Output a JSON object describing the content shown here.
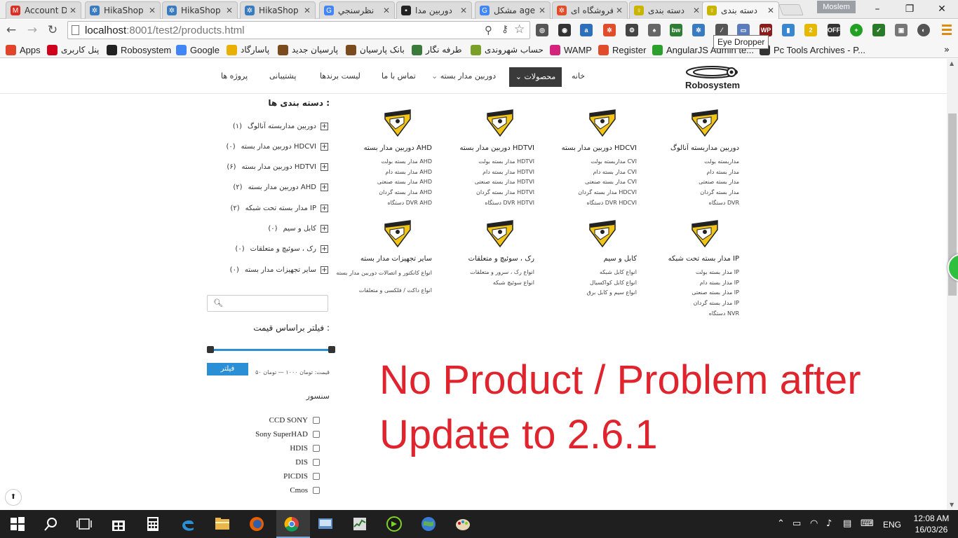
{
  "browser": {
    "tabs": [
      {
        "label": "Account D",
        "icon": "gmail-icon",
        "color": "#d93025",
        "glyph": "M"
      },
      {
        "label": "HikaShop -",
        "icon": "joomla-icon",
        "color": "#3a7bbf",
        "glyph": "✲"
      },
      {
        "label": "HikaShop -",
        "icon": "joomla-icon",
        "color": "#3a7bbf",
        "glyph": "✲"
      },
      {
        "label": "HikaShop -",
        "icon": "joomla-icon",
        "color": "#3a7bbf",
        "glyph": "✲"
      },
      {
        "label": "نظرسنجي",
        "icon": "google-icon",
        "color": "#4285f4",
        "glyph": "G"
      },
      {
        "label": "دوربين مدا",
        "icon": "camera-icon",
        "color": "#222222",
        "glyph": "▪"
      },
      {
        "label": "مشكل age",
        "icon": "google-icon",
        "color": "#4285f4",
        "glyph": "G"
      },
      {
        "label": "فروشگاه ای",
        "icon": "joomla-icon",
        "color": "#e14d2a",
        "glyph": "✲"
      },
      {
        "label": "دسته بندی",
        "icon": "bulb-icon",
        "color": "#c9b400",
        "glyph": "♀"
      },
      {
        "label": "دسته بندی",
        "icon": "bulb-icon",
        "color": "#c9b400",
        "glyph": "♀"
      }
    ],
    "profile_name": "Moslem",
    "url_host": "localhost",
    "url_rest": ":8001/test2/products.html",
    "tooltip": "Eye Dropper",
    "bookmarks": [
      {
        "label": "Apps",
        "color": "#e0452b"
      },
      {
        "label": "پنل کاربری",
        "color": "#d0021b"
      },
      {
        "label": "Robosystem",
        "color": "#222222"
      },
      {
        "label": "Google",
        "color": "#4285f4"
      },
      {
        "label": "پاسارگاد",
        "color": "#e8b000"
      },
      {
        "label": "پارسیان جدید",
        "color": "#7a4b1c"
      },
      {
        "label": "بانک پارسیان",
        "color": "#7a4b1c"
      },
      {
        "label": "طرفه نگار",
        "color": "#3a7a3a"
      },
      {
        "label": "حساب شهروندی",
        "color": "#7aa02a"
      },
      {
        "label": "WAMP",
        "color": "#d4237a"
      },
      {
        "label": "Register",
        "color": "#e14d2a"
      },
      {
        "label": "AngularJS Admin te...",
        "color": "#2ca02c"
      },
      {
        "label": "Pc Tools Archives - P...",
        "color": "#333333"
      }
    ]
  },
  "site": {
    "logo_text": "Robosystem",
    "nav": {
      "home": "خانه",
      "products": "محصولات",
      "cctv": "دوربین مدار بسته",
      "contact": "تماس با ما",
      "brands": "لیست برندها",
      "support": "پشتیبانی",
      "projects": "پروژه ها"
    },
    "sidebar": {
      "title": "دسته بندی ها :",
      "categories": [
        {
          "label": "دوربین مداربسته آنالوگ",
          "count": "(۱)"
        },
        {
          "label": "دوربین مدار بسته HDCVI",
          "count": "(۰)"
        },
        {
          "label": "دوربین مدار بسته HDTVI",
          "count": "(۶)"
        },
        {
          "label": "دوربین مدار بسته AHD",
          "count": "(۲)"
        },
        {
          "label": "مدار بسته تحت شبکه IP",
          "count": "(۲)"
        },
        {
          "label": "کابل و سیم",
          "count": "(۰)"
        },
        {
          "label": "رک ، سوئیچ و متعلقات",
          "count": "(۰)"
        },
        {
          "label": "سایر تجهیزات مدار بسته",
          "count": "(۰)"
        }
      ],
      "price_title": "فیلتر براساس قیمت :",
      "filter_button": "فیلتر",
      "price_range": "قیمت: تومان ۱۰۰۰ — تومان ۵۰",
      "price_min_fraction": 0,
      "price_max_fraction": 1,
      "sensor_title": "سنسور",
      "sensors": [
        "CCD SONY",
        "Sony SuperHAD",
        "HDIS",
        "DIS",
        "PICDIS",
        "Cmos"
      ]
    },
    "grid": [
      {
        "title": "دوربین مداربسته آنالوگ",
        "subs": [
          "مداربسته بولت",
          "مدار بسته دام",
          "مدار بسته صنعتی",
          "مدار بسته گردان",
          "دستگاه DVR"
        ]
      },
      {
        "title": "دوربین مدار بسته HDCVI",
        "subs": [
          "مداربسته بولت CVI",
          "مدار بسته دام CVI",
          "مدار بسته صنعتی CVI",
          "مدار بسته گردان HDCVI",
          "دستگاه DVR HDCVI"
        ]
      },
      {
        "title": "دوربین مدار بسته HDTVI",
        "subs": [
          "مدار بسته بولت HDTVI",
          "مدار بسته دام HDTVI",
          "مدار بسته صنعتی HDTVI",
          "مدار بسته گردان HDTVI",
          "دستگاه DVR HDTVI"
        ]
      },
      {
        "title": "دوربین مدار بسته AHD",
        "subs": [
          "مدار بسته بولت AHD",
          "مدار بسته دام AHD",
          "مدار بسته صنعتی AHD",
          "مدار بسته گردان AHD",
          "دستگاه DVR AHD"
        ]
      },
      {
        "title": "مدار بسته تحت شبکه IP",
        "subs": [
          "مدار بسته بولت IP",
          "مدار بسته دام IP",
          "مدار بسته صنعتی IP",
          "مدار بسته گردان IP",
          "دستگاه NVR"
        ]
      },
      {
        "title": "کابل و سیم",
        "subs": [
          "انواع کابل شبکه",
          "انواع کابل کواکسیال",
          "انواع سیم و کابل برق"
        ]
      },
      {
        "title": "رک ، سوئیچ و متعلقات",
        "subs": [
          "انواع رک ، سرور و متعلقات",
          "انواع سوئیچ شبکه"
        ]
      },
      {
        "title": "سایر تجهیزات مدار بسته",
        "subs": [
          "انواع کانکتور و اتصالات دوربین مدار بسته",
          "انواع داکت / فلکسی و متعلقات"
        ]
      }
    ],
    "notice_line1": "No Product / Problem after",
    "notice_line2": "Update to 2.6.1"
  },
  "taskbar": {
    "language": "ENG",
    "time": "12:08 AM",
    "date": "16/03/26"
  },
  "colors": {
    "notice": "#e0242d",
    "accent": "#2b8fd6",
    "mascot_yellow": "#f0c419"
  }
}
